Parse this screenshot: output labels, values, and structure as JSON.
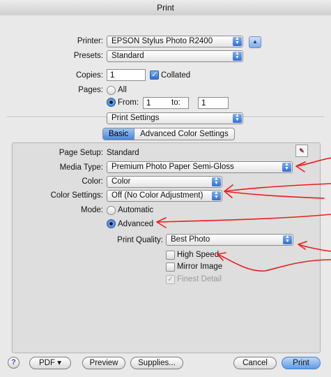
{
  "window": {
    "title": "Print"
  },
  "printer": {
    "label": "Printer:",
    "value": "EPSON Stylus Photo R2400"
  },
  "presets": {
    "label": "Presets:",
    "value": "Standard"
  },
  "copies": {
    "label": "Copies:",
    "value": "1",
    "collated_label": "Collated",
    "collated_checked": true
  },
  "pages": {
    "label": "Pages:",
    "all_label": "All",
    "from_label": "From:",
    "from_value": "1",
    "to_label": "to:",
    "to_value": "1"
  },
  "section_popup": {
    "value": "Print Settings"
  },
  "tabs": [
    {
      "label": "Basic",
      "selected": true
    },
    {
      "label": "Advanced Color Settings",
      "selected": false
    }
  ],
  "settings": {
    "page_setup_label": "Page Setup:",
    "page_setup_value": "Standard",
    "media_type_label": "Media Type:",
    "media_type_value": "Premium Photo Paper Semi-Gloss",
    "color_label": "Color:",
    "color_value": "Color",
    "color_settings_label": "Color Settings:",
    "color_settings_value": "Off (No Color Adjustment)",
    "mode_label": "Mode:",
    "mode_automatic": "Automatic",
    "mode_advanced": "Advanced",
    "print_quality_label": "Print Quality:",
    "print_quality_value": "Best Photo",
    "high_speed": "High Speed",
    "mirror_image": "Mirror Image",
    "finest_detail": "Finest Detail"
  },
  "footer": {
    "help": "?",
    "pdf": "PDF ▾",
    "preview": "Preview",
    "supplies": "Supplies...",
    "cancel": "Cancel",
    "print": "Print"
  },
  "colors": {
    "annotation": "#ee1c1c",
    "accent": "#3a78dc"
  }
}
